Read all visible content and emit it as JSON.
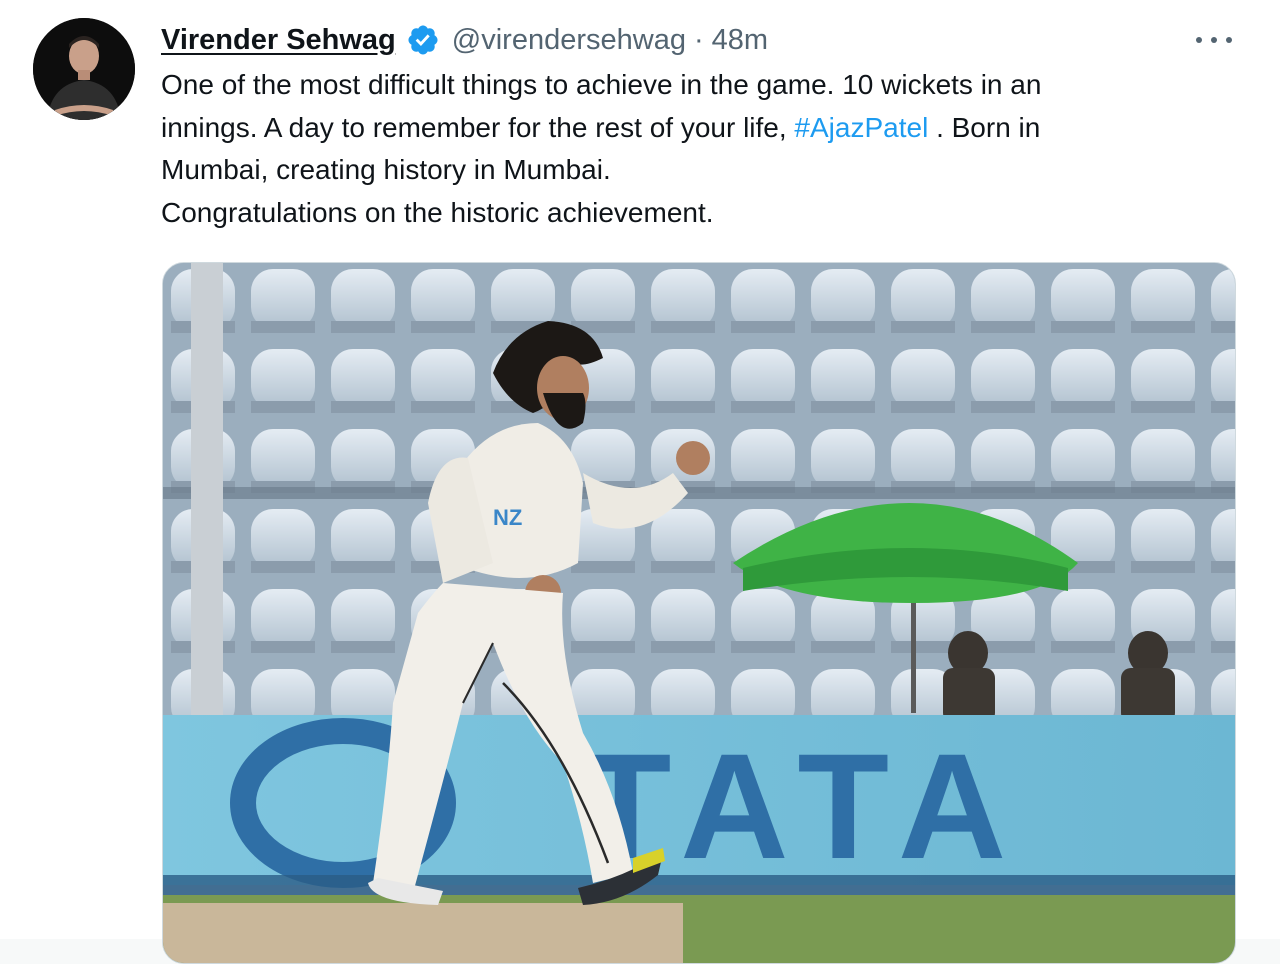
{
  "tweet": {
    "author_name": "Virender Sehwag",
    "author_handle": "@virendersehwag",
    "separator": "·",
    "timestamp": "48m",
    "verified": true,
    "text_segments": {
      "line1": "One of the most difficult things to achieve in the game. 10 wickets in an",
      "line2_before": "innings. A day to remember for the rest of your life, ",
      "hashtag": "#AjazPatel",
      "line2_after": " . Born in",
      "line3": "Mumbai, creating history in Mumbai.",
      "line4": "Congratulations on the historic achievement."
    },
    "media": {
      "banner_text": "TATA",
      "jersey_text": "NZ"
    }
  },
  "colors": {
    "hashtag": "#1d9bf0",
    "verified_badge": "#1d9bf0",
    "secondary_text": "#536471",
    "banner": "#74c1dc",
    "umbrella": "#3fb346"
  },
  "icons": [
    "verified-badge-icon",
    "more-options-icon"
  ]
}
